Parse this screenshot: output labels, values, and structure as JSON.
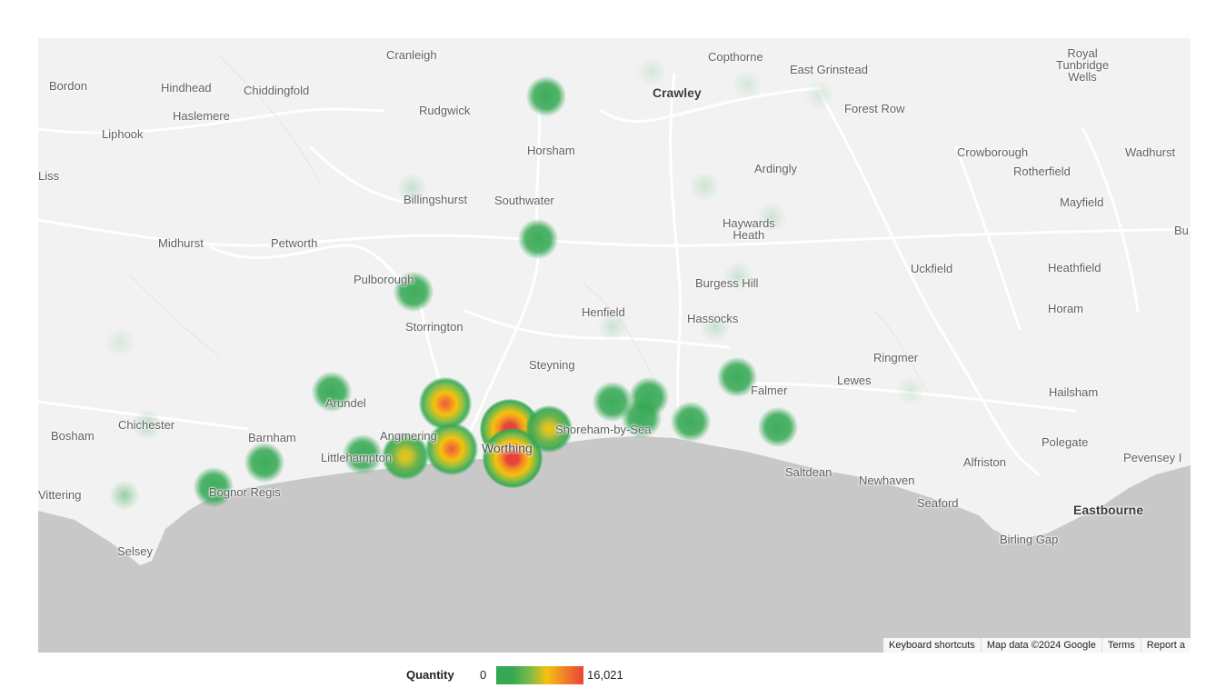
{
  "places": [
    {
      "id": "cranleigh",
      "name": "Cranleigh",
      "cls": ""
    },
    {
      "id": "copthorne",
      "name": "Copthorne",
      "cls": ""
    },
    {
      "id": "east-grinstead",
      "name": "East Grinstead",
      "cls": ""
    },
    {
      "id": "royal-tunbridge-wells",
      "name": "Royal\nTunbridge\nWells",
      "cls": ""
    },
    {
      "id": "bordon",
      "name": "Bordon",
      "cls": ""
    },
    {
      "id": "hindhead",
      "name": "Hindhead",
      "cls": ""
    },
    {
      "id": "chiddingfold",
      "name": "Chiddingfold",
      "cls": ""
    },
    {
      "id": "rudgwick",
      "name": "Rudgwick",
      "cls": ""
    },
    {
      "id": "crawley",
      "name": "Crawley",
      "cls": "major"
    },
    {
      "id": "forest-row",
      "name": "Forest Row",
      "cls": ""
    },
    {
      "id": "haslemere",
      "name": "Haslemere",
      "cls": ""
    },
    {
      "id": "liphook",
      "name": "Liphook",
      "cls": ""
    },
    {
      "id": "horsham",
      "name": "Horsham",
      "cls": ""
    },
    {
      "id": "crowborough",
      "name": "Crowborough",
      "cls": ""
    },
    {
      "id": "wadhurst",
      "name": "Wadhurst",
      "cls": ""
    },
    {
      "id": "liss",
      "name": "Liss",
      "cls": ""
    },
    {
      "id": "ardingly",
      "name": "Ardingly",
      "cls": ""
    },
    {
      "id": "rotherfield",
      "name": "Rotherfield",
      "cls": ""
    },
    {
      "id": "billingshurst",
      "name": "Billingshurst",
      "cls": ""
    },
    {
      "id": "southwater",
      "name": "Southwater",
      "cls": ""
    },
    {
      "id": "mayfield",
      "name": "Mayfield",
      "cls": ""
    },
    {
      "id": "haywards-heath",
      "name": "Haywards\nHeath",
      "cls": ""
    },
    {
      "id": "bu",
      "name": "Bu",
      "cls": ""
    },
    {
      "id": "midhurst",
      "name": "Midhurst",
      "cls": ""
    },
    {
      "id": "petworth",
      "name": "Petworth",
      "cls": ""
    },
    {
      "id": "uckfield",
      "name": "Uckfield",
      "cls": ""
    },
    {
      "id": "heathfield",
      "name": "Heathfield",
      "cls": ""
    },
    {
      "id": "pulborough",
      "name": "Pulborough",
      "cls": ""
    },
    {
      "id": "burgess-hill",
      "name": "Burgess Hill",
      "cls": ""
    },
    {
      "id": "horam",
      "name": "Horam",
      "cls": ""
    },
    {
      "id": "henfield",
      "name": "Henfield",
      "cls": ""
    },
    {
      "id": "hassocks",
      "name": "Hassocks",
      "cls": ""
    },
    {
      "id": "storrington",
      "name": "Storrington",
      "cls": ""
    },
    {
      "id": "ringmer",
      "name": "Ringmer",
      "cls": ""
    },
    {
      "id": "steyning",
      "name": "Steyning",
      "cls": ""
    },
    {
      "id": "lewes",
      "name": "Lewes",
      "cls": ""
    },
    {
      "id": "falmer",
      "name": "Falmer",
      "cls": ""
    },
    {
      "id": "arundel",
      "name": "Arundel",
      "cls": ""
    },
    {
      "id": "hailsham",
      "name": "Hailsham",
      "cls": ""
    },
    {
      "id": "chichester",
      "name": "Chichester",
      "cls": ""
    },
    {
      "id": "shoreham-by-sea",
      "name": "Shoreham-by-Sea",
      "cls": ""
    },
    {
      "id": "bosham",
      "name": "Bosham",
      "cls": ""
    },
    {
      "id": "barnham",
      "name": "Barnham",
      "cls": ""
    },
    {
      "id": "angmering",
      "name": "Angmering",
      "cls": ""
    },
    {
      "id": "polegate",
      "name": "Polegate",
      "cls": ""
    },
    {
      "id": "worthing",
      "name": "Worthing",
      "cls": "town"
    },
    {
      "id": "littlehampton",
      "name": "Littlehampton",
      "cls": ""
    },
    {
      "id": "alfriston",
      "name": "Alfriston",
      "cls": ""
    },
    {
      "id": "pevensey",
      "name": "Pevensey I",
      "cls": ""
    },
    {
      "id": "saltdean",
      "name": "Saltdean",
      "cls": ""
    },
    {
      "id": "newhaven",
      "name": "Newhaven",
      "cls": ""
    },
    {
      "id": "bognor-regis",
      "name": "Bognor Regis",
      "cls": ""
    },
    {
      "id": "wittering",
      "name": "Vittering",
      "cls": ""
    },
    {
      "id": "seaford",
      "name": "Seaford",
      "cls": ""
    },
    {
      "id": "eastbourne",
      "name": "Eastbourne",
      "cls": "major"
    },
    {
      "id": "birling-gap",
      "name": "Birling Gap",
      "cls": ""
    },
    {
      "id": "selsey",
      "name": "Selsey",
      "cls": ""
    }
  ],
  "heat_points": [
    {
      "place": "worthing-north",
      "intensity": 0.95
    },
    {
      "place": "worthing-south",
      "intensity": 0.95
    },
    {
      "place": "findon",
      "intensity": 0.85
    },
    {
      "place": "ferring",
      "intensity": 0.75
    },
    {
      "place": "lancing",
      "intensity": 0.6
    },
    {
      "place": "littlehampton",
      "intensity": 0.55
    },
    {
      "place": "shoreham",
      "intensity": 0.3
    },
    {
      "place": "upper-beeding",
      "intensity": 0.25
    },
    {
      "place": "southwick",
      "intensity": 0.2
    },
    {
      "place": "brighton",
      "intensity": 0.2
    },
    {
      "place": "falmer-n",
      "intensity": 0.2
    },
    {
      "place": "falmer",
      "intensity": 0.2
    },
    {
      "place": "wick",
      "intensity": 0.2
    },
    {
      "place": "barnham",
      "intensity": 0.2
    },
    {
      "place": "bognor",
      "intensity": 0.15
    },
    {
      "place": "arundel",
      "intensity": 0.15
    },
    {
      "place": "pulborough",
      "intensity": 0.2
    },
    {
      "place": "southwater",
      "intensity": 0.2
    },
    {
      "place": "crawley-s",
      "intensity": 0.18
    },
    {
      "place": "wittering",
      "intensity": 0.12
    },
    {
      "place": "chichester",
      "intensity": 0.08
    },
    {
      "place": "henfield",
      "intensity": 0.05
    },
    {
      "place": "hassocks",
      "intensity": 0.06
    },
    {
      "place": "burgess-hill",
      "intensity": 0.05
    },
    {
      "place": "billingshurst",
      "intensity": 0.06
    },
    {
      "place": "balcombe",
      "intensity": 0.05
    },
    {
      "place": "haywards-heath",
      "intensity": 0.05
    },
    {
      "place": "copthorne",
      "intensity": 0.03
    },
    {
      "place": "crawley-e",
      "intensity": 0.03
    },
    {
      "place": "east-grinstead",
      "intensity": 0.02
    },
    {
      "place": "lewes",
      "intensity": 0.02
    },
    {
      "place": "selsey-w",
      "intensity": 0.02
    }
  ],
  "attribution": {
    "shortcuts": "Keyboard shortcuts",
    "map_data": "Map data ©2024 Google",
    "terms": "Terms",
    "report": "Report a"
  },
  "legend": {
    "label": "Quantity",
    "min": "0",
    "max": "16,021"
  },
  "colors": {
    "land": "#f2f2f2",
    "sea": "#c8c8c8",
    "road": "#ffffff",
    "heat_low": "#34a853",
    "heat_mid": "#f4c20d",
    "heat_high": "#ea4335"
  }
}
